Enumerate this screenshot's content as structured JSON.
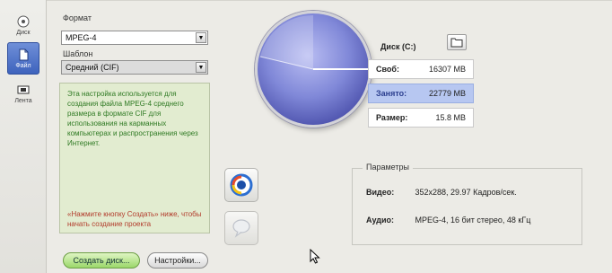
{
  "sidebar": {
    "items": [
      {
        "label": "Диск",
        "icon": "disc-icon"
      },
      {
        "label": "Файл",
        "icon": "file-icon"
      },
      {
        "label": "Лента",
        "icon": "tape-icon"
      }
    ],
    "active_index": 1
  },
  "format": {
    "label": "Формат",
    "value": "MPEG-4"
  },
  "template": {
    "label": "Шаблон",
    "value": "Средний (CIF)"
  },
  "info": {
    "description": "Эта настройка используется для создания файла MPEG-4 среднего размера в формате CIF для использования на карманных компьютерах и распространения через Интернет.",
    "hint": "«Нажмите кнопку Создать» ниже, чтобы начать создание проекта"
  },
  "buttons": {
    "create": "Создать диск...",
    "settings": "Настройки..."
  },
  "disk": {
    "title": "Диск (C:)",
    "free_label": "Своб:",
    "free_value": "16307 MB",
    "used_label": "Занято:",
    "used_value": "22779 MB",
    "size_label": "Размер:",
    "size_value": "15.8 MB"
  },
  "params": {
    "title": "Параметры",
    "video_label": "Видео:",
    "video_value": "352x288, 29.97 Кадров/сек.",
    "audio_label": "Аудио:",
    "audio_value": "MPEG-4, 16 бит стерео, 48 кГц"
  },
  "colors": {
    "accent": "#3e63bd",
    "used_highlight": "#b7c7f1",
    "disc": "#8088d8",
    "create_button": "#9bd86a"
  }
}
